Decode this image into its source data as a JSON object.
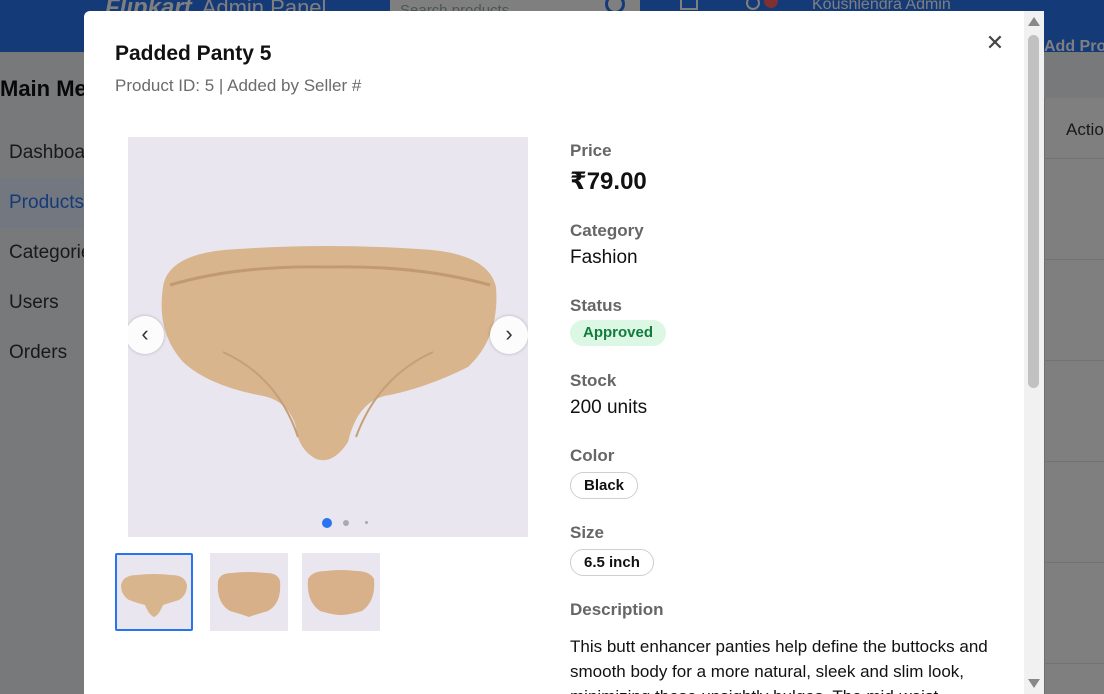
{
  "app": {
    "brand": "Flipkart",
    "brand_sub": "Admin Panel",
    "search_placeholder": "Search products...",
    "user_name": "Koushlendra Admin"
  },
  "sidebar": {
    "title": "Main Menu",
    "items": [
      {
        "label": "Dashboard",
        "active": false
      },
      {
        "label": "Products",
        "active": true
      },
      {
        "label": "Categories",
        "active": false
      },
      {
        "label": "Users",
        "active": false
      },
      {
        "label": "Orders",
        "active": false
      }
    ]
  },
  "content": {
    "header_button": "Add Product",
    "actions_column": "Actions"
  },
  "modal": {
    "title": "Padded Panty 5",
    "subtitle": "Product ID: 5 | Added by Seller #",
    "close_icon": "close-icon",
    "carousel": {
      "prev_icon": "chevron-left-icon",
      "next_icon": "chevron-right-icon",
      "active_index": 0,
      "image_count": 3
    },
    "price_label": "Price",
    "price_value": "₹79.00",
    "category_label": "Category",
    "category_value": "Fashion",
    "status_label": "Status",
    "status_value": "Approved",
    "stock_label": "Stock",
    "stock_value": "200 units",
    "color_label": "Color",
    "color_value": "Black",
    "size_label": "Size",
    "size_value": "6.5 inch",
    "description_label": "Description",
    "description_text": "This butt enhancer panties help define the buttocks and smooth body for a more natural, sleek and slim look, minimizing those unsightly bulges. The mid-waist"
  },
  "colors": {
    "primary": "#2874f0",
    "approved_bg": "#dcf7e4",
    "approved_text": "#137c3c",
    "product_beige": "#d7b28a"
  }
}
